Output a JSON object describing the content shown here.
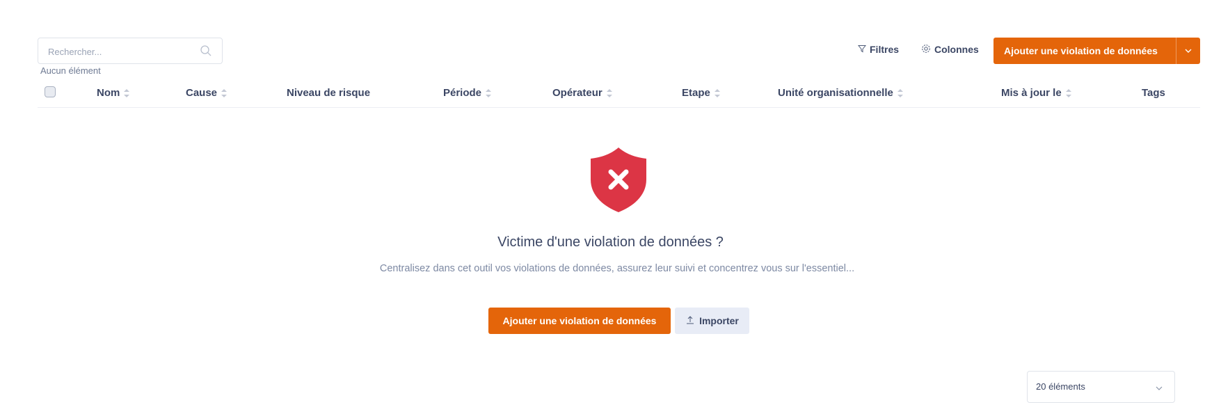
{
  "search": {
    "placeholder": "Rechercher...",
    "icon": "search-icon"
  },
  "results_count": "Aucun élément",
  "toolbar": {
    "filters_label": "Filtres",
    "columns_label": "Colonnes",
    "add_label": "Ajouter une violation de données"
  },
  "table": {
    "columns": [
      {
        "label": "Nom",
        "sortable": true
      },
      {
        "label": "Cause",
        "sortable": true
      },
      {
        "label": "Niveau de risque",
        "sortable": false
      },
      {
        "label": "Période",
        "sortable": true
      },
      {
        "label": "Opérateur",
        "sortable": true
      },
      {
        "label": "Etape",
        "sortable": true
      },
      {
        "label": "Unité organisationnelle",
        "sortable": true
      },
      {
        "label": "Mis à jour le",
        "sortable": true
      },
      {
        "label": "Tags",
        "sortable": false
      }
    ]
  },
  "empty_state": {
    "icon": "shield-x-icon",
    "title": "Victime d'une violation de données ?",
    "description": "Centralisez dans cet outil vos violations de données, assurez leur suivi et concentrez vous sur l'essentiel...",
    "primary_button": "Ajouter une violation de données",
    "secondary_button": "Importer"
  },
  "pagination": {
    "page_size": "20 éléments"
  },
  "colors": {
    "accent": "#e4650a",
    "shield": "#dc3545",
    "text": "#3b4664"
  }
}
